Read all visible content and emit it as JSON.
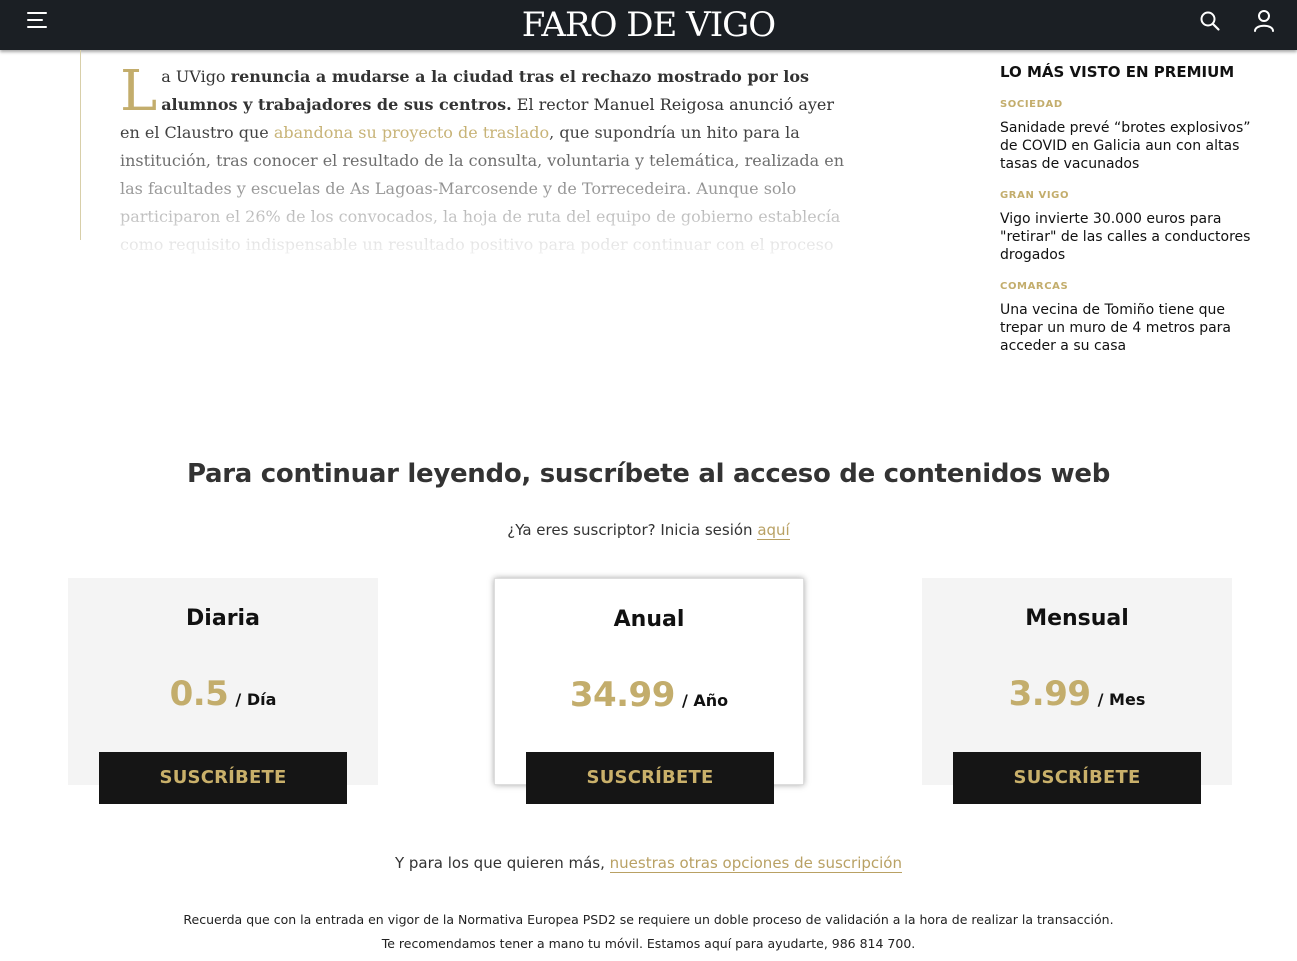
{
  "header": {
    "logo_text": "FARO DE VIGO",
    "icons": [
      "menu-icon",
      "search-icon",
      "user-icon"
    ]
  },
  "article": {
    "dropcap": "L",
    "p1_start": "a UVigo ",
    "p1_bold": "renuncia a mudarse a la ciudad tras el rechazo mostrado por los alumnos y trabajadores de sus centros.",
    "p1_mid": " El rector Manuel Reigosa anunció ayer en el Claustro que ",
    "p1_link": "abandona su proyecto de traslado",
    "p1_end": ", que supondría un hito para la institución, tras conocer el resultado de la consulta, voluntaria y telemática, realizada en las facultades y escuelas de As Lagoas-Marcosende y de Torrecedeira. Aunque solo participaron el 26% de los convocados, la hoja de ruta del equipo de gobierno establecía como requisito indispensable un resultado positivo para poder continuar con el proceso"
  },
  "sidebar": {
    "title": "LO MÁS VISTO EN PREMIUM",
    "items": [
      {
        "category": "SOCIEDAD",
        "headline": "Sanidade prevé “brotes explosivos” de COVID en Galicia aun con altas tasas de vacunados"
      },
      {
        "category": "GRAN VIGO",
        "headline": "Vigo invierte 30.000 euros para \"retirar\" de las calles a conductores drogados"
      },
      {
        "category": "COMARCAS",
        "headline": "Una vecina de Tomiño tiene que trepar un muro de 4 metros para acceder a su casa"
      }
    ]
  },
  "paywall": {
    "title": "Para continuar leyendo, suscríbete al acceso de contenidos web",
    "login_text": "¿Ya eres suscriptor? Inicia sesión ",
    "login_link": "aquí",
    "plans": [
      {
        "name": "Diaria",
        "price": "0.5",
        "unit": "/ Día",
        "button": "SUSCRÍBETE"
      },
      {
        "name": "Anual",
        "price": "34.99",
        "unit": "/ Año",
        "button": "SUSCRÍBETE"
      },
      {
        "name": "Mensual",
        "price": "3.99",
        "unit": "/ Mes",
        "button": "SUSCRÍBETE"
      }
    ],
    "more_text": "Y para los que quieren más, ",
    "more_link": "nuestras otras opciones de suscripción",
    "note_line1": "Recuerda que con la entrada en vigor de la Normativa Europea PSD2 se requiere un doble proceso de validación a la hora de realizar la transacción.",
    "note_line2": "Te recomendamos tener a mano tu móvil. Estamos aquí para ayudarte, 986 814 700."
  },
  "colors": {
    "header_bg": "#1b1f24",
    "gold": "#c3ad6c",
    "button_bg": "#151515",
    "card_bg": "#f4f4f4"
  }
}
